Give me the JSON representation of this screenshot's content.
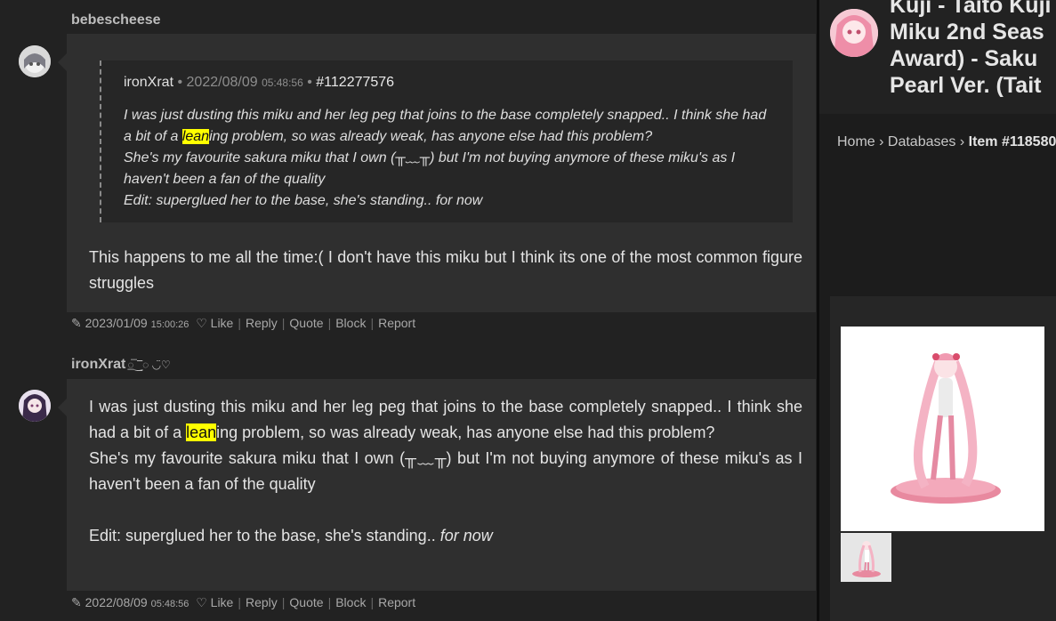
{
  "posts": [
    {
      "username": "bebescheese",
      "quote": {
        "author": "ironXrat",
        "date": "2022/08/09",
        "time": "05:48:56",
        "post_id": "#112277576",
        "line1_before": "I was just dusting this miku and her leg peg that joins to the base completely snapped.. I think she had a bit of a ",
        "highlight": "lean",
        "line1_after": "ing problem, so was already weak, has anyone else had this problem?",
        "line2": "She's my favourite sakura miku that I own (╥﹏╥) but I'm not buying anymore of these miku's as I haven't been a fan of the quality",
        "line3": "Edit: superglued her to the base, she's standing.. for now"
      },
      "body": "This happens to me all the time:( I don't have this miku but I think its one of the most common figure struggles",
      "meta": {
        "date": "2023/01/09",
        "time": "15:00:26"
      }
    },
    {
      "username": "ironXrat",
      "username_deco": "◌̲̅‿̲̅◌ ◡̈♡",
      "body_before": "I was just dusting this miku and her leg peg that joins to the base completely snapped.. I think she had a bit of a ",
      "highlight": "lean",
      "body_after": "ing problem, so was already weak, has anyone else had this problem?",
      "body_line2": "She's my favourite sakura miku that I own (╥﹏╥) but I'm not buying anymore of these miku's as I haven't been a fan of the quality",
      "edit_text": "Edit: superglued her to the base, she's standing.. ",
      "edit_italic": "for now",
      "meta": {
        "date": "2022/08/09",
        "time": "05:48:56"
      }
    }
  ],
  "actions": {
    "like": "Like",
    "reply": "Reply",
    "quote": "Quote",
    "block": "Block",
    "report": "Report"
  },
  "sidebar": {
    "title_lines": [
      "Kuji - Taito Kuji",
      "Miku 2nd Seas",
      "Award) - Saku",
      "Pearl Ver. (Tait"
    ],
    "breadcrumb": {
      "home": "Home",
      "databases": "Databases",
      "item": "Item #118580"
    }
  },
  "colors": {
    "highlight": "#ffff00",
    "background": "#222222",
    "bubble": "#2f2f2f"
  }
}
